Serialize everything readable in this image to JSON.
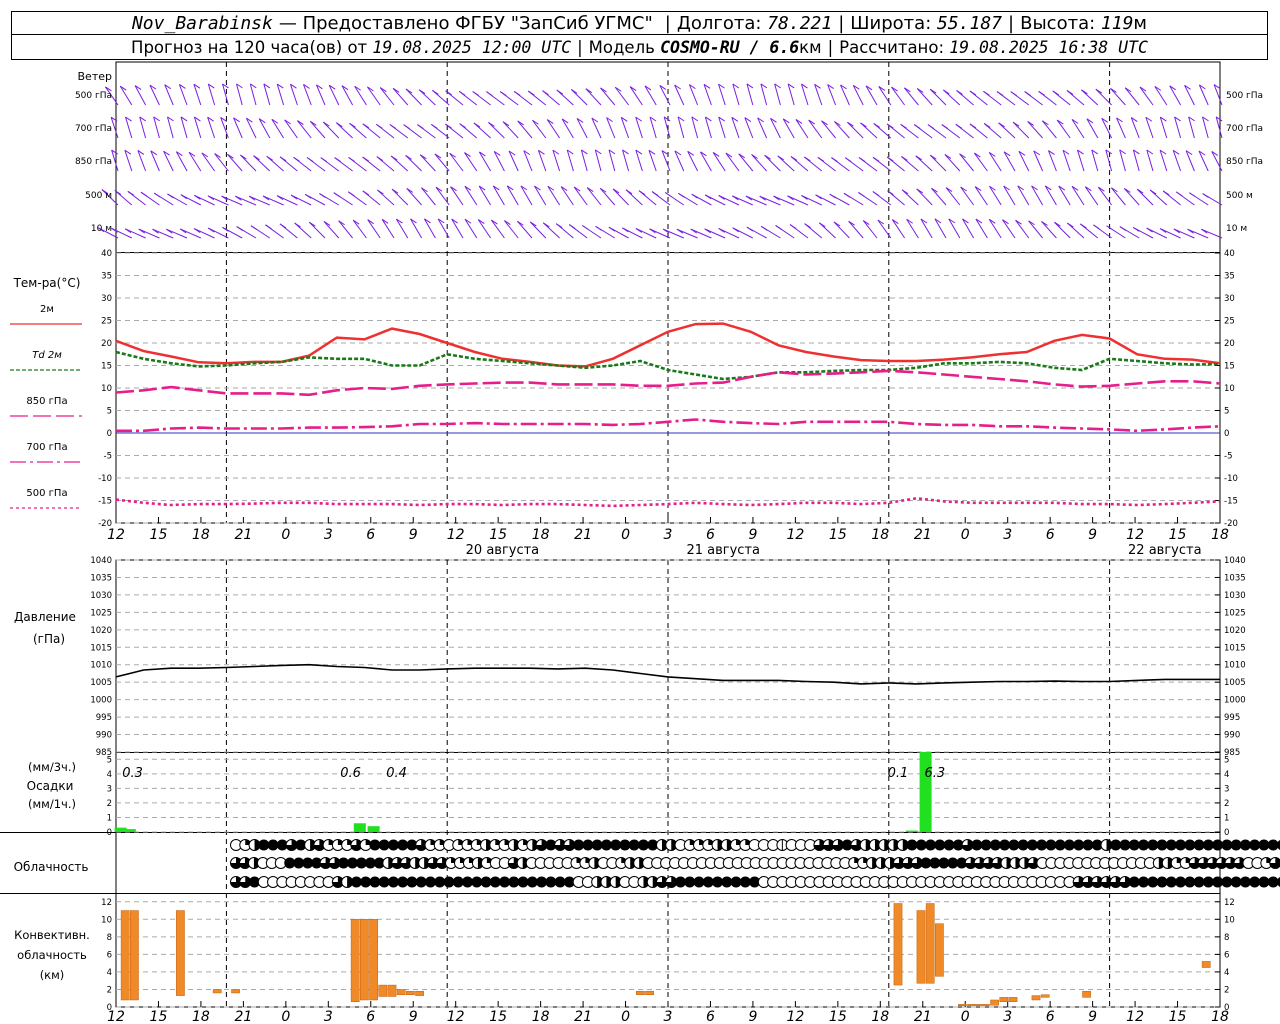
{
  "header": {
    "station": "Nov_Barabinsk",
    "provider": "— Предоставлено ФГБУ \"ЗапСиб УГМС\"",
    "lon_label": "Долгота:",
    "lon": "78.221",
    "lat_label": "Широта:",
    "lat": "55.187",
    "alt_label": "Высота:",
    "alt": "119",
    "alt_unit": "м",
    "forecast_label": "Прогноз на 120 часа(ов) от",
    "forecast_start": "19.08.2025 12:00 UTC",
    "model_label": "Модель",
    "model": "COSMO-RU / 6.6",
    "model_unit": "км",
    "computed_label": "Рассчитано:",
    "computed": "19.08.2025 16:38 UTC"
  },
  "chart_data": [
    {
      "type": "line",
      "panel": "wind",
      "ylabel": "Ветер",
      "levels": [
        "500 гПа",
        "700 гПа",
        "850 гПа",
        "500 м",
        "10 м"
      ]
    },
    {
      "type": "line",
      "panel": "temperature",
      "ylabel": "Тем-ра(°С)",
      "ylim": [
        -20,
        40
      ],
      "yticks": [
        -20,
        -15,
        -10,
        -5,
        0,
        5,
        10,
        15,
        20,
        25,
        30,
        35,
        40
      ],
      "x_hours": [
        0,
        3,
        6,
        9,
        12,
        15,
        18,
        21,
        24,
        27,
        30,
        33,
        36,
        39,
        42,
        45,
        48,
        51,
        54,
        57,
        60,
        63,
        66,
        69,
        72,
        75,
        78,
        81,
        84,
        87,
        90,
        93,
        96,
        99,
        102,
        105,
        108,
        111,
        114,
        117,
        120
      ],
      "series": [
        {
          "name": "2м",
          "color": "#ee3030",
          "dash": "",
          "values": [
            20.5,
            18.2,
            17,
            15.7,
            15.5,
            15.8,
            15.8,
            17.2,
            21.2,
            20.8,
            23.2,
            22,
            20,
            18,
            16.5,
            15.8,
            15,
            14.8,
            16.5,
            19.5,
            22.5,
            24.2,
            24.3,
            22.5,
            19.5,
            18,
            17,
            16.2,
            16,
            16,
            16.3,
            16.8,
            17.5,
            18,
            20.5,
            21.8,
            21,
            17.5,
            16.5,
            16.3,
            15.5
          ]
        },
        {
          "name": "Td  2м",
          "color": "#1a7a1a",
          "dash": "4,2",
          "values": [
            18,
            16.5,
            15.5,
            14.8,
            15,
            15.5,
            15.8,
            16.8,
            16.5,
            16.5,
            15,
            15,
            17.5,
            16.5,
            16,
            15.5,
            15,
            14.5,
            15,
            16,
            14,
            13,
            12,
            12.5,
            13.5,
            13.5,
            13.8,
            14,
            14,
            14.5,
            15.5,
            15.5,
            15.8,
            15.5,
            14.5,
            14,
            16.5,
            16,
            15.5,
            15.2,
            15.3
          ]
        },
        {
          "name": "850 гПа",
          "color": "#e61e8c",
          "dash": "18,5",
          "values": [
            9,
            9.5,
            10.2,
            9.5,
            8.8,
            8.8,
            8.8,
            8.5,
            9.5,
            10,
            9.8,
            10.5,
            10.8,
            11,
            11.2,
            11.2,
            10.8,
            10.8,
            10.8,
            10.5,
            10.5,
            11,
            11.2,
            12.5,
            13.5,
            13,
            13.2,
            13.5,
            13.8,
            13.5,
            13,
            12.5,
            12,
            11.5,
            10.8,
            10.3,
            10.5,
            11,
            11.5,
            11.5,
            11
          ]
        },
        {
          "name": "700 гПа",
          "color": "#e61e8c",
          "dash": "16,4,3,4",
          "values": [
            0.5,
            0.5,
            1,
            1.2,
            1,
            1,
            1,
            1.2,
            1.2,
            1.3,
            1.5,
            2,
            2,
            2.2,
            2,
            2,
            2,
            2,
            1.8,
            2,
            2.5,
            3,
            2.5,
            2.2,
            2,
            2.5,
            2.5,
            2.5,
            2.5,
            2,
            1.8,
            1.8,
            1.5,
            1.5,
            1.2,
            1,
            0.8,
            0.5,
            0.8,
            1.2,
            1.5
          ]
        },
        {
          "name": "500 гПа",
          "color": "#e61e8c",
          "dash": "3,3",
          "values": [
            -14.8,
            -15.5,
            -16,
            -15.8,
            -15.8,
            -15.7,
            -15.5,
            -15.5,
            -15.8,
            -15.8,
            -15.8,
            -16,
            -15.8,
            -15.8,
            -16,
            -15.8,
            -15.8,
            -16,
            -16.2,
            -16,
            -15.8,
            -15.5,
            -15.8,
            -16,
            -15.8,
            -15.5,
            -15.5,
            -15.8,
            -15.5,
            -14.5,
            -15.2,
            -15.5,
            -15.5,
            -15.5,
            -15.5,
            -15.8,
            -15.8,
            -16,
            -15.8,
            -15.5,
            -15.2
          ]
        }
      ]
    },
    {
      "type": "line",
      "panel": "pressure",
      "ylabel": "Давление",
      "yunit": "(гПа)",
      "ylim": [
        985,
        1040
      ],
      "yticks": [
        985,
        990,
        995,
        1000,
        1005,
        1010,
        1015,
        1020,
        1025,
        1030,
        1035,
        1040
      ],
      "series": [
        {
          "name": "",
          "color": "#000000",
          "values": [
            1006.5,
            1008.5,
            1009,
            1009,
            1009.2,
            1009.5,
            1009.8,
            1010,
            1009.5,
            1009.2,
            1008.5,
            1008.5,
            1008.8,
            1009,
            1009,
            1009,
            1008.8,
            1009,
            1008.5,
            1007.5,
            1006.5,
            1006,
            1005.5,
            1005.5,
            1005.5,
            1005.2,
            1005,
            1004.5,
            1004.8,
            1004.5,
            1004.8,
            1005,
            1005.2,
            1005.2,
            1005.3,
            1005.2,
            1005.2,
            1005.5,
            1005.8,
            1005.8,
            1005.8
          ]
        }
      ]
    },
    {
      "type": "bar",
      "panel": "precipitation",
      "ylabel": "Осадки",
      "yunit_top": "(мм/3ч.)",
      "yunit_bottom": "(мм/1ч.)",
      "ylim": [
        0,
        5.5
      ],
      "yticks": [
        0,
        1,
        2,
        3,
        4,
        5
      ],
      "bars": [
        {
          "h": 0.5,
          "v": 0.3
        },
        {
          "h": 1.5,
          "v": 0.2
        },
        {
          "h": 26.5,
          "v": 0.6
        },
        {
          "h": 28,
          "v": 0.4
        },
        {
          "h": 86.5,
          "v": 0.1
        },
        {
          "h": 88,
          "v": 5.5
        }
      ],
      "labels": [
        {
          "h": 1.8,
          "text": "0.3"
        },
        {
          "h": 25.5,
          "text": "0.6"
        },
        {
          "h": 30.5,
          "text": "0.4"
        },
        {
          "h": 85,
          "text": "0.1"
        },
        {
          "h": 89,
          "text": "6.3"
        }
      ]
    },
    {
      "type": "table",
      "panel": "cloudiness",
      "ylabel": "Облачность",
      "rows": [
        [
          0,
          3,
          5,
          8,
          8,
          8,
          6,
          8,
          5,
          6,
          3,
          3,
          3,
          6,
          3,
          8,
          8,
          8,
          8,
          8,
          6,
          3,
          3,
          0,
          3,
          3,
          3,
          5,
          3,
          3,
          5,
          3,
          5,
          6,
          8,
          6,
          6,
          8,
          8,
          8,
          8,
          8,
          8,
          8,
          8,
          8,
          5,
          5,
          0,
          3,
          3,
          3,
          5,
          5,
          3,
          3,
          0,
          0,
          0,
          0,
          0,
          0,
          0,
          6,
          6,
          6,
          8,
          6,
          5,
          5,
          5,
          5,
          5,
          8,
          8,
          8,
          8,
          8,
          8,
          6,
          8,
          8,
          8,
          8,
          8,
          8,
          8,
          8,
          8,
          8,
          8,
          8,
          8,
          8,
          5,
          8,
          8,
          8,
          8,
          8,
          8,
          8,
          8,
          8,
          8,
          8,
          8,
          8,
          8,
          8,
          8,
          8,
          8,
          8,
          8,
          8,
          8,
          8,
          6,
          0
        ],
        [
          6,
          6,
          5,
          0,
          0,
          0,
          8,
          8,
          8,
          8,
          6,
          6,
          8,
          8,
          8,
          8,
          8,
          5,
          6,
          6,
          5,
          5,
          6,
          6,
          3,
          3,
          3,
          5,
          3,
          0,
          0,
          6,
          5,
          0,
          0,
          0,
          0,
          0,
          3,
          3,
          5,
          0,
          0,
          3,
          5,
          5,
          0,
          0,
          0,
          0,
          0,
          0,
          0,
          0,
          0,
          0,
          0,
          0,
          0,
          0,
          0,
          0,
          0,
          0,
          0,
          0,
          0,
          0,
          0,
          3,
          3,
          5,
          5,
          5,
          6,
          6,
          6,
          8,
          8,
          8,
          8,
          8,
          6,
          6,
          6,
          6,
          5,
          5,
          5,
          6,
          0,
          0,
          0,
          0,
          0,
          0,
          0,
          0,
          0,
          0,
          0,
          0,
          0,
          5,
          5,
          3,
          3,
          6,
          6,
          6,
          6,
          6,
          6,
          0,
          0,
          3,
          6,
          8,
          8,
          8,
          8,
          6,
          5,
          5
        ],
        [
          6,
          6,
          8,
          0,
          0,
          0,
          0,
          0,
          0,
          0,
          0,
          6,
          5,
          8,
          8,
          8,
          8,
          8,
          8,
          8,
          8,
          8,
          8,
          8,
          8,
          8,
          8,
          8,
          8,
          8,
          8,
          8,
          8,
          8,
          8,
          8,
          8,
          0,
          0,
          5,
          5,
          5,
          0,
          0,
          5,
          5,
          6,
          6,
          8,
          8,
          8,
          8,
          8,
          8,
          8,
          8,
          8,
          0,
          0,
          0,
          0,
          0,
          0,
          0,
          0,
          0,
          0,
          0,
          0,
          0,
          0,
          0,
          0,
          0,
          0,
          0,
          0,
          0,
          0,
          0,
          0,
          0,
          0,
          0,
          0,
          0,
          0,
          0,
          0,
          0,
          0,
          6,
          6,
          6,
          6,
          6,
          6,
          8,
          8,
          8,
          8,
          8,
          8,
          8,
          8,
          8,
          8,
          8,
          8,
          8,
          8,
          8,
          8,
          8,
          0,
          0,
          0,
          0,
          0,
          0
        ]
      ]
    },
    {
      "type": "bar",
      "panel": "convective",
      "ylabel": [
        "Конвективн.",
        "облачность",
        "(км)"
      ],
      "ylim": [
        0,
        13
      ],
      "yticks": [
        0,
        2,
        4,
        6,
        8,
        10,
        12
      ],
      "bars": [
        {
          "h0": 0.5,
          "h1": 1.5,
          "lo": 0.8,
          "hi": 11
        },
        {
          "h0": 1.5,
          "h1": 2.5,
          "lo": 0.8,
          "hi": 11
        },
        {
          "h0": 6.5,
          "h1": 7.5,
          "lo": 1.3,
          "hi": 11
        },
        {
          "h0": 10.5,
          "h1": 11.5,
          "lo": 1.6,
          "hi": 2
        },
        {
          "h0": 12.5,
          "h1": 13.5,
          "lo": 1.6,
          "hi": 2
        },
        {
          "h0": 25.5,
          "h1": 26.5,
          "lo": 0.6,
          "hi": 10
        },
        {
          "h0": 26.5,
          "h1": 27.5,
          "lo": 0.8,
          "hi": 10
        },
        {
          "h0": 27.5,
          "h1": 28.5,
          "lo": 0.8,
          "hi": 10
        },
        {
          "h0": 28.5,
          "h1": 29.5,
          "lo": 1.2,
          "hi": 2.5
        },
        {
          "h0": 29.5,
          "h1": 30.5,
          "lo": 1.2,
          "hi": 2.5
        },
        {
          "h0": 30.5,
          "h1": 31.5,
          "lo": 1.4,
          "hi": 2
        },
        {
          "h0": 31.5,
          "h1": 32.5,
          "lo": 1.4,
          "hi": 1.8
        },
        {
          "h0": 32.5,
          "h1": 33.5,
          "lo": 1.3,
          "hi": 1.8
        },
        {
          "h0": 56.5,
          "h1": 57.5,
          "lo": 1.4,
          "hi": 1.8
        },
        {
          "h0": 57.5,
          "h1": 58.5,
          "lo": 1.4,
          "hi": 1.8
        },
        {
          "h0": 84.5,
          "h1": 85.5,
          "lo": 2.5,
          "hi": 11.8
        },
        {
          "h0": 87,
          "h1": 88,
          "lo": 2.7,
          "hi": 11
        },
        {
          "h0": 88,
          "h1": 89,
          "lo": 2.7,
          "hi": 11.8
        },
        {
          "h0": 89,
          "h1": 90,
          "lo": 3.5,
          "hi": 9.5
        },
        {
          "h0": 91.5,
          "h1": 92.5,
          "lo": 0.15,
          "hi": 0.3
        },
        {
          "h0": 92.5,
          "h1": 95,
          "lo": 0.15,
          "hi": 0.3
        },
        {
          "h0": 95,
          "h1": 96,
          "lo": 0.2,
          "hi": 0.8
        },
        {
          "h0": 96,
          "h1": 97,
          "lo": 0.6,
          "hi": 1.1
        },
        {
          "h0": 97,
          "h1": 98,
          "lo": 0.6,
          "hi": 1.1
        },
        {
          "h0": 99.5,
          "h1": 100.5,
          "lo": 0.8,
          "hi": 1.3
        },
        {
          "h0": 100.5,
          "h1": 101.5,
          "lo": 1.1,
          "hi": 1.4
        },
        {
          "h0": 105,
          "h1": 106,
          "lo": 1.1,
          "hi": 1.8
        },
        {
          "h0": 118,
          "h1": 119,
          "lo": 4.5,
          "hi": 5.2
        }
      ]
    }
  ],
  "axis": {
    "hour_labels": [
      "12",
      "15",
      "18",
      "21",
      "0",
      "3",
      "6",
      "9",
      "12",
      "15",
      "18",
      "21",
      "0",
      "3",
      "6",
      "9",
      "12",
      "15",
      "18",
      "21",
      "0",
      "3",
      "6",
      "9",
      "12",
      "15",
      "18"
    ],
    "dates": [
      {
        "h": 42,
        "text": "20 августа"
      },
      {
        "h": 66,
        "text": "21 августа"
      },
      {
        "h": 114,
        "text": "22 августа"
      }
    ]
  },
  "legend": {
    "title": "Тем-ра(°С)",
    "items": [
      "2м",
      "Td  2м",
      "850 гПа",
      "700 гПа",
      "500 гПа"
    ]
  }
}
